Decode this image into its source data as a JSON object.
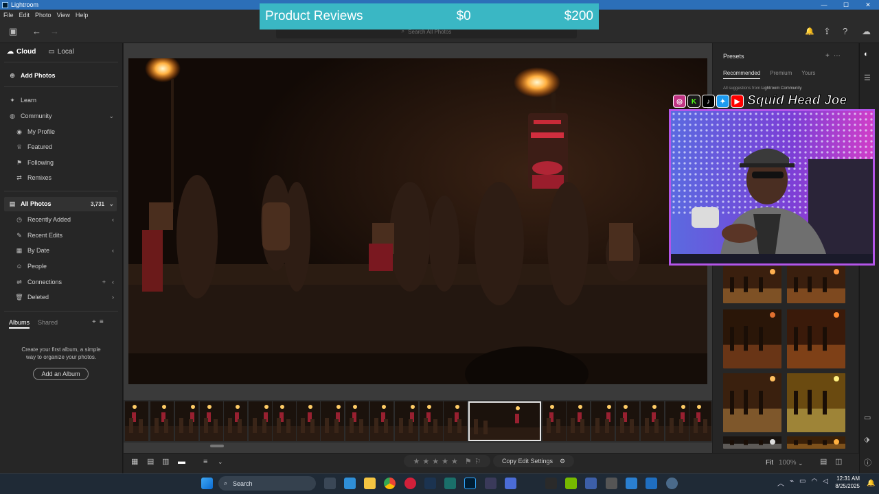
{
  "window": {
    "title": "Lightroom",
    "minimize": "—",
    "maximize": "☐",
    "close": "✕"
  },
  "menu": [
    "File",
    "Edit",
    "Photo",
    "View",
    "Help"
  ],
  "search": {
    "placeholder": "Search All Photos"
  },
  "overlay_banner": {
    "label": "Product Reviews",
    "low": "$0",
    "high": "$200"
  },
  "sidebar": {
    "tabs": {
      "cloud": "Cloud",
      "local": "Local"
    },
    "add_photos": "Add Photos",
    "learn": "Learn",
    "community": "Community",
    "community_items": [
      "My Profile",
      "Featured",
      "Following",
      "Remixes"
    ],
    "all_photos": "All Photos",
    "all_photos_count": "3,731",
    "all_photos_items": [
      "Recently Added",
      "Recent Edits",
      "By Date",
      "People",
      "Connections",
      "Deleted"
    ],
    "albums_tab": "Albums",
    "shared_tab": "Shared",
    "album_hint": "Create your first album, a simple way to organize your photos.",
    "add_album": "Add an Album"
  },
  "bottom": {
    "copy_edit": "Copy Edit Settings",
    "fit": "Fit",
    "zoom": "100%"
  },
  "presets": {
    "title": "Presets",
    "tabs": [
      "Recommended",
      "Premium",
      "Yours"
    ],
    "suggest_text": "All suggestions from",
    "suggest_source": "Lightroom Community"
  },
  "webcam": {
    "name": "Squid Head Joe",
    "socials": [
      "instagram-icon",
      "kick-icon",
      "tiktok-icon",
      "twitter-icon",
      "youtube-icon"
    ]
  },
  "taskbar": {
    "search": "Search",
    "time": "12:31 AM",
    "date": "8/25/2025"
  },
  "colors": {
    "accent_banner": "#3ab7c4",
    "titlebar": "#2c6fb8",
    "cam_border": "#b455e8"
  }
}
